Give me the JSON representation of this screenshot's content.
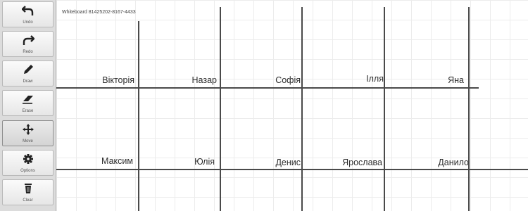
{
  "toolbar": {
    "items": [
      {
        "label": "Undo",
        "icon": "undo-icon"
      },
      {
        "label": "Redo",
        "icon": "redo-icon"
      },
      {
        "label": "Draw",
        "icon": "pencil-icon"
      },
      {
        "label": "Erase",
        "icon": "eraser-icon"
      },
      {
        "label": "Move",
        "icon": "move-icon"
      },
      {
        "label": "Options",
        "icon": "gear-icon"
      },
      {
        "label": "Clear",
        "icon": "trash-icon"
      }
    ],
    "active": "Move"
  },
  "board": {
    "title": "Whiteboard 81425202-8167-4433",
    "row1": [
      "Вікторія",
      "Назар",
      "Софія",
      "Ілля",
      "Яна"
    ],
    "row2": [
      "Максим",
      "Юлія",
      "Денис",
      "Ярослава",
      "Данило"
    ]
  }
}
